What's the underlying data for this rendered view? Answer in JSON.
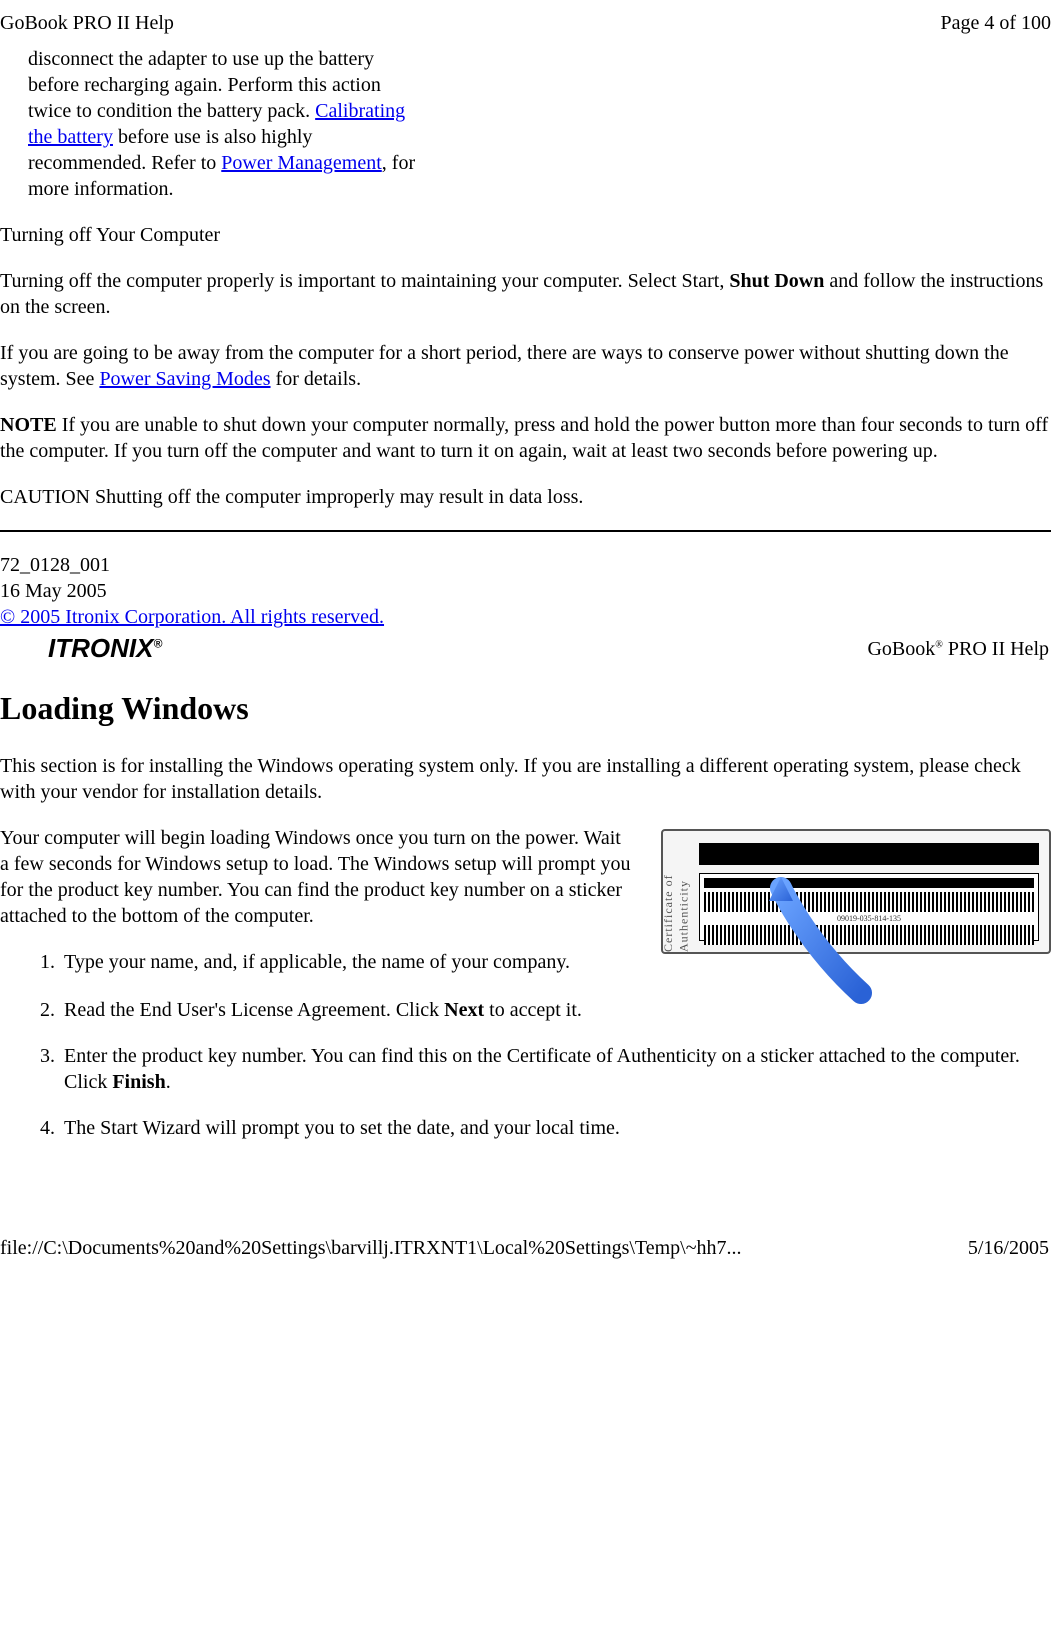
{
  "header": {
    "left": "GoBook PRO II Help",
    "right": "Page 4 of 100"
  },
  "paragraphs": {
    "intro_indented_1": "disconnect the adapter to use up the battery before recharging again. Perform this action twice to condition the battery pack. ",
    "link_calibrating": "Calibrating the battery",
    "intro_indented_2": " before use is also highly recommended. Refer to ",
    "link_power_mgmt": "Power Management",
    "intro_indented_3": ", for more information.",
    "turning_off_heading": "Turning off Your Computer",
    "turning_off_para_1a": "Turning off the computer properly is important to maintaining your computer.  Select Start, ",
    "shut_down_bold": "Shut Down",
    "turning_off_para_1b": " and follow the instructions on the screen.",
    "turning_off_para_2a": "If you are going to be away from the computer for a short period, there are ways to conserve power without shutting down the system. See ",
    "link_power_saving": "Power Saving Modes",
    "turning_off_para_2b": " for details.",
    "note_label": "NOTE",
    "note_text": "  If you are unable to shut down your computer normally, press and hold the power button more than four seconds to turn off the computer. If you turn off the computer and want to turn it on again, wait at least two seconds before powering up.",
    "caution_text": "CAUTION  Shutting off the computer improperly may result in data loss."
  },
  "doc_info": {
    "part_number": " 72_0128_001",
    "date": "16 May 2005",
    "copyright_link": "© 2005 Itronix Corporation.  All rights reserved."
  },
  "logo": {
    "text": "ITRONIX",
    "reg": "®"
  },
  "gobook_label_pre": "GoBook",
  "gobook_label_sup": "®",
  "gobook_label_post": " PRO II Help",
  "section_title": "Loading Windows",
  "loading": {
    "para1": "This section is for installing the Windows operating system only. If you are installing a different operating system, please check with your vendor for installation details.",
    "para2": "Your computer will begin loading Windows once you turn on the power. Wait a few seconds for Windows setup to load. The Windows setup will prompt you for the product key number.  You can find the product key number on a sticker attached to the bottom of the computer."
  },
  "steps": {
    "s1": "Type your name, and, if applicable, the name of your company.",
    "s2a": "Read the End User's License Agreement. Click ",
    "s2_bold": "Next",
    "s2b": " to accept it.",
    "s3a": "Enter the product key number. You can find this on the Certificate of Authenticity on a sticker attached to the computer. Click ",
    "s3_bold": "Finish",
    "s3b": ".",
    "s4": "The Start Wizard will prompt you to set the date, and your local time."
  },
  "image_labels": {
    "side_left": "Certificate of Authenticity",
    "barcode_number": "09019-035-814-135"
  },
  "footer": {
    "left": "file://C:\\Documents%20and%20Settings\\barvillj.ITRXNT1\\Local%20Settings\\Temp\\~hh7...",
    "right": "5/16/2005"
  }
}
